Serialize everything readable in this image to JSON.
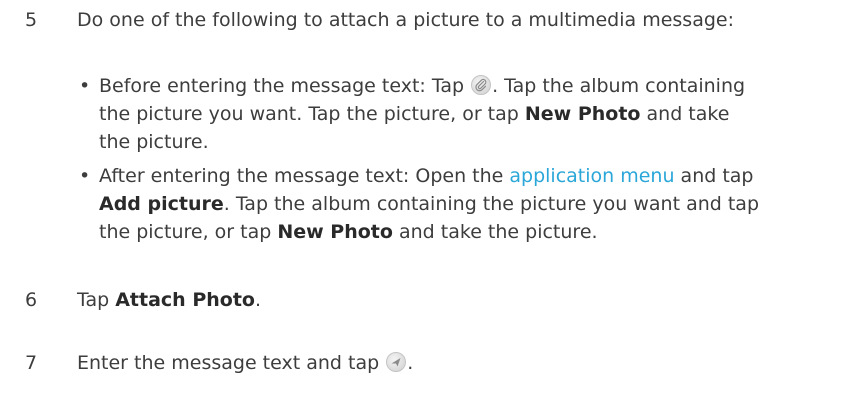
{
  "steps": [
    {
      "num": "5",
      "text": "Do one of the following to attach a picture to a multimedia message:"
    },
    {
      "num": "6",
      "pre": "Tap ",
      "bold": "Attach Photo",
      "post": "."
    },
    {
      "num": "7",
      "pre": "Enter the message text and tap ",
      "post": "."
    }
  ],
  "bullets": [
    {
      "dot": "•",
      "l1_a": "Before entering the message text: Tap ",
      "l1_b": ". Tap the album containing",
      "l2": "the picture you want. Tap the picture, or tap ",
      "l2_bold": "New Photo",
      "l2_post": " and take",
      "l3": "the picture."
    },
    {
      "dot": "•",
      "l1_a": "After entering the message text: Open the ",
      "l1_link": "application menu",
      "l1_b": " and tap",
      "l2_bold": "Add picture",
      "l2": ". Tap the album containing the picture you want and tap",
      "l3_a": "the picture, or tap ",
      "l3_bold": "New Photo",
      "l3_b": " and take the picture."
    }
  ],
  "icons": {
    "attach": "paperclip-icon",
    "send": "send-icon"
  },
  "colors": {
    "text": "#3d3d3d",
    "link": "#2aa7d8"
  }
}
